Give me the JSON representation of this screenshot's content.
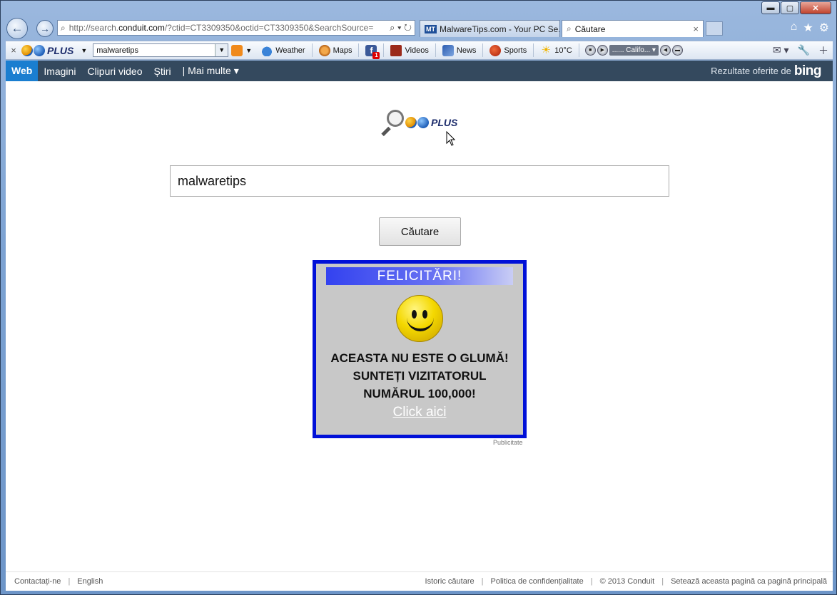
{
  "window": {
    "minimize": "▬",
    "maximize": "▢",
    "close": "✕"
  },
  "address_bar": {
    "url_prefix": "http://search.",
    "url_domain": "conduit.com",
    "url_rest": "/?ctid=CT3309350&octid=CT3309350&SearchSource=",
    "tools": "⌕ ▾ ↻"
  },
  "tabs": [
    {
      "label": "MalwareTips.com - Your PC Se...",
      "favicon": "MT"
    },
    {
      "label": "Căutare",
      "close": "×"
    }
  ],
  "toolbar": {
    "logo_text": "PLUS",
    "search_value": "malwaretips",
    "weather_label": "Weather",
    "maps_label": "Maps",
    "fb_badge": "1",
    "videos_label": "Videos",
    "news_label": "News",
    "sports_label": "Sports",
    "temperature": "10°C",
    "radio_station": "...... Califo..."
  },
  "bing_nav": {
    "items": [
      "Web",
      "Imagini",
      "Clipuri video",
      "Știri",
      "| Mai multe ▾"
    ],
    "results_text": "Rezultate oferite de",
    "bing_text": "bing"
  },
  "main": {
    "logo_text": "PLUS",
    "search_value": "malwaretips",
    "search_button": "Căutare"
  },
  "ad": {
    "heading": "FELICITĂRI!",
    "line1": "ACEASTA NU ESTE O GLUMĂ!",
    "line2": "SUNTEȚI VIZITATORUL",
    "line3": "NUMĂRUL 100,000!",
    "link": "Click aici",
    "label": "Publicitate"
  },
  "footer": {
    "contact": "Contactați-ne",
    "language": "English",
    "history": "Istoric căutare",
    "privacy": "Politica de confidențialitate",
    "copyright": "© 2013 Conduit",
    "homepage": "Setează aceasta pagină ca pagină principală"
  }
}
